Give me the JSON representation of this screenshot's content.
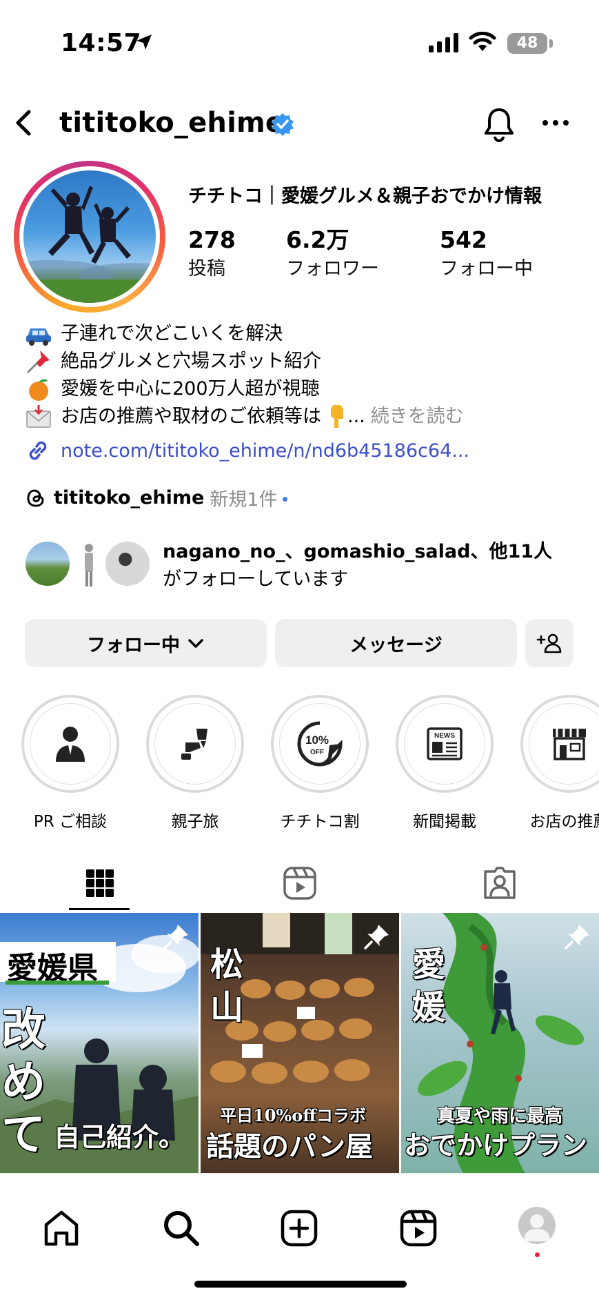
{
  "status_bar": {
    "time": "14:57",
    "battery": "48"
  },
  "header": {
    "username": "tititoko_ehime"
  },
  "profile": {
    "display_name": "チチトコ｜愛媛グルメ＆親子おでかけ情報",
    "stats": [
      {
        "value": "278",
        "label": "投稿"
      },
      {
        "value": "6.2万",
        "label": "フォロワー"
      },
      {
        "value": "542",
        "label": "フォロー中"
      }
    ]
  },
  "bio": {
    "lines": [
      {
        "icon": "car-emoji",
        "text": "子連れで次どこいくを解決"
      },
      {
        "icon": "pushpin-emoji",
        "text": "絶品グルメと穴場スポット紹介"
      },
      {
        "icon": "orange-emoji",
        "text": "愛媛を中心に200万人超が視聴"
      },
      {
        "icon": "envelope-emoji",
        "text": "お店の推薦や取材のご依頼等は"
      }
    ],
    "ellipsis": "...",
    "more": "続きを読む",
    "link": "note.com/tititoko_ehime/n/nd6b45186c64..."
  },
  "threads": {
    "name": "tititoko_ehime",
    "new": "新規1件"
  },
  "mutual": {
    "line1": "nagano_no_、gomashio_salad、他11人",
    "line2": "がフォローしています"
  },
  "buttons": {
    "following": "フォロー中",
    "message": "メッセージ"
  },
  "highlights": [
    {
      "label": "PR ご相談",
      "icon": "person-icon"
    },
    {
      "label": "親子旅",
      "icon": "car-seat-icon"
    },
    {
      "label": "チチトコ割",
      "icon": "discount-sticker-icon",
      "badge": "10%",
      "badge_sub": "OFF"
    },
    {
      "label": "新聞掲載",
      "icon": "newspaper-icon",
      "badge": "NEWS"
    },
    {
      "label": "お店の推薦",
      "icon": "store-icon"
    }
  ],
  "posts": [
    {
      "tag": "愛媛県",
      "big": [
        "改",
        "め",
        "て"
      ],
      "caption": "自己紹介。"
    },
    {
      "side": [
        "松",
        "山"
      ],
      "sub": "平日10%offコラボ",
      "caption": "話題のパン屋"
    },
    {
      "side": [
        "愛",
        "媛"
      ],
      "sub": "真夏や雨に最高",
      "caption": "おでかけプラン"
    }
  ],
  "colors": {
    "link": "#3b4ec8",
    "verified": "#3897f0",
    "button_bg": "#efefef",
    "muted": "#8e8e8e"
  }
}
